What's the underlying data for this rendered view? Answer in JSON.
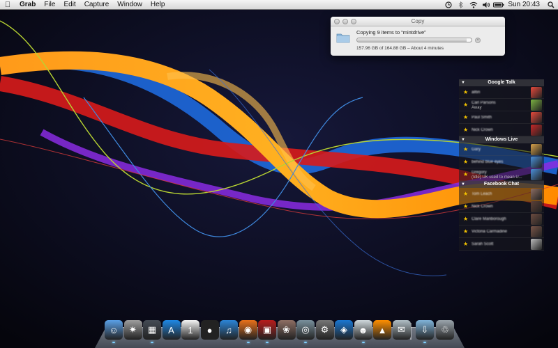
{
  "menubar": {
    "app_name": "Grab",
    "menus": [
      "File",
      "Edit",
      "Capture",
      "Window",
      "Help"
    ],
    "clock": "Sun 20:43"
  },
  "copy_window": {
    "title": "Copy",
    "message": "Copying 9 items to “mintdrive”",
    "progress_text": "157.96 GB of 164.88 GB – About 4 minutes",
    "progress_fraction": 0.958
  },
  "buddy_list": {
    "groups": [
      {
        "name": "Google Talk",
        "buddies": [
          {
            "name": "alltin",
            "status": "",
            "avatar": "speech-bubble-icon",
            "color": "#e84a3c"
          },
          {
            "name": "Carl Parsons",
            "status": "Away",
            "avatar": "stack-icon",
            "color": "#7cb342"
          },
          {
            "name": "Paul Smith",
            "status": "",
            "avatar": "speech-bubble-icon",
            "color": "#e84a3c"
          },
          {
            "name": "Nick Crown",
            "status": "",
            "avatar": "person-icon",
            "color": "#c62828"
          }
        ]
      },
      {
        "name": "Windows Live",
        "buddies": [
          {
            "name": "Gary",
            "status": "",
            "avatar": "turtle-icon",
            "color": "#d9a24a"
          },
          {
            "name": "behind blue eyes",
            "status": "",
            "avatar": "people-icon",
            "color": "#4a90d9"
          },
          {
            "name": "Gregory",
            "status": "(Idle) UK used to mean U...",
            "avatar": "people-icon",
            "color": "#4a90d9"
          }
        ]
      },
      {
        "name": "Facebook Chat",
        "buddies": [
          {
            "name": "Tom Leach",
            "status": "",
            "avatar": "photo-icon",
            "color": "#8d6e63"
          },
          {
            "name": "Nick Crown",
            "status": "",
            "avatar": "photo-icon",
            "color": "#5d4037"
          },
          {
            "name": "Clare Manborough",
            "status": "",
            "avatar": "photo-icon",
            "color": "#6d4c41"
          },
          {
            "name": "Victoria Carmadine",
            "status": "",
            "avatar": "photo-icon",
            "color": "#795548"
          },
          {
            "name": "Sarah Scott",
            "status": "",
            "avatar": "photo-icon",
            "color": "#bdbdbd"
          }
        ]
      }
    ]
  },
  "dock": {
    "items": [
      {
        "name": "finder-icon",
        "color": "#5aa0e6",
        "glyph": "☺"
      },
      {
        "name": "launchpad-icon",
        "color": "#9e9e9e",
        "glyph": "✷"
      },
      {
        "name": "mission-control-icon",
        "color": "#444b55",
        "glyph": "▦"
      },
      {
        "name": "app-store-icon",
        "color": "#1e88e5",
        "glyph": "A"
      },
      {
        "name": "calendar-icon",
        "color": "#f5f5f5",
        "glyph": "1"
      },
      {
        "name": "dvd-player-icon",
        "color": "#222222",
        "glyph": "●"
      },
      {
        "name": "itunes-icon",
        "color": "#2b84d6",
        "glyph": "♫"
      },
      {
        "name": "firefox-icon",
        "color": "#e8701a",
        "glyph": "◉"
      },
      {
        "name": "photo-booth-icon",
        "color": "#b71c1c",
        "glyph": "▣"
      },
      {
        "name": "iphoto-icon",
        "color": "#8d6e63",
        "glyph": "❀"
      },
      {
        "name": "image-capture-icon",
        "color": "#78909c",
        "glyph": "◎"
      },
      {
        "name": "system-preferences-icon",
        "color": "#757575",
        "glyph": "⚙"
      },
      {
        "name": "virtualbox-icon",
        "color": "#1976d2",
        "glyph": "◈"
      },
      {
        "name": "alien-icon",
        "color": "#cfd8dc",
        "glyph": "☻"
      },
      {
        "name": "vlc-icon",
        "color": "#ff8f00",
        "glyph": "▲"
      },
      {
        "name": "archive-icon",
        "color": "#b0bec5",
        "glyph": "✉"
      },
      {
        "name": "downloads-folder-icon",
        "color": "#7fb3d9",
        "glyph": "⇩"
      },
      {
        "name": "trash-icon",
        "color": "#9aa4ac",
        "glyph": "♲"
      }
    ],
    "running": [
      0,
      2,
      7,
      8,
      10,
      13,
      16
    ]
  }
}
